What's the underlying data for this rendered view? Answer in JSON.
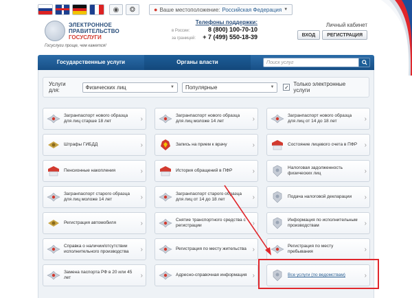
{
  "topbar": {
    "location_label": "Ваше местоположение:",
    "region": "Российская Федерация",
    "flags": [
      "ru-flag",
      "uk-flag",
      "de-flag",
      "fr-flag"
    ]
  },
  "header": {
    "logo_line1": "ЭЛЕКТРОННОЕ",
    "logo_line2": "ПРАВИТЕЛЬСТВО",
    "logo_line3": "ГОСУСЛУГИ",
    "slogan": "Госуслуги проще, чем кажется!",
    "phones_title": "Телефоны поддержки:",
    "phone_ru_label": "в России:",
    "phone_ru": "8 (800) 100-70-10",
    "phone_abroad_label": "за границей:",
    "phone_abroad": "+ 7 (499) 550-18-39",
    "cabinet_title": "Личный кабинет",
    "login_label": "ВХОД",
    "register_label": "РЕГИСТРАЦИЯ"
  },
  "nav": {
    "tab1": "Государственные услуги",
    "tab2": "Органы власти",
    "search_placeholder": "Поиск услуг"
  },
  "filter": {
    "label": "Услуги для:",
    "audience": "Физических лиц",
    "sort": "Популярные",
    "only_electronic": "Только электронные услуги",
    "only_electronic_checked": true
  },
  "services": [
    "Загранпаспорт нового образца для лиц старше 18 лет",
    "Загранпаспорт нового образца для лиц моложе 14 лет",
    "Загранпаспорт нового образца для лиц от 14 до 18 лет",
    "Штрафы ГИБДД",
    "Запись на прием к врачу",
    "Состояние лицевого счета в ПФР",
    "Пенсионные накопления",
    "История обращений в ПФР",
    "Налоговая задолженность физических лиц",
    "Загранпаспорт старого образца для лиц моложе 14 лет",
    "Загранпаспорт старого образца для лиц от 14 до 18 лет",
    "Подача налоговой декларации",
    "Регистрация автомобиля",
    "Снятие транспортного средства с регистрации",
    "Информация по исполнительным производствам",
    "Справка о наличии/отсутствии исполнительного производства",
    "Регистрация по месту жительства",
    "Регистрация по месту пребывания",
    "Замена паспорта РФ в 20 или 45 лет",
    "Адресно-справочная информация",
    "Все услуги (по ведомствам)"
  ],
  "colors": {
    "nav_blue": "#1d5e98",
    "highlight_red": "#e0262b",
    "link_blue": "#2a5f93"
  }
}
